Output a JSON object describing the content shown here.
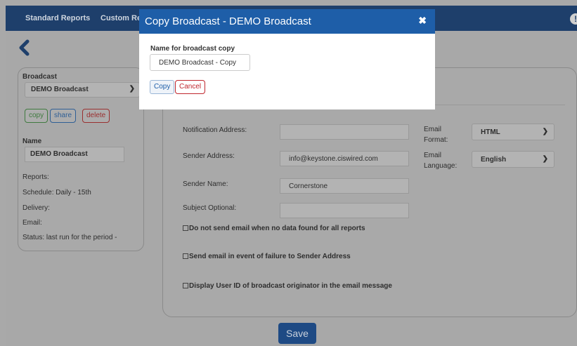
{
  "topbar": {
    "items": [
      "Standard Reports",
      "Custom Repo"
    ],
    "alert_icon": "!"
  },
  "broadcast_panel": {
    "broadcast_label": "Broadcast",
    "broadcast_selected": "DEMO Broadcast",
    "buttons": {
      "copy": "copy",
      "share": "share",
      "delete": "delete"
    },
    "name_label": "Name",
    "name_value": "DEMO Broadcast",
    "reports": "Reports:",
    "schedule": "Schedule: Daily - 15th",
    "delivery": "Delivery:",
    "email": "Email:",
    "status": "Status: last run for the period -"
  },
  "form": {
    "notification_label": "Notification Address:",
    "notification_value": "",
    "sender_address_label": "Sender Address:",
    "sender_address_value": "info@keystone.ciswired.com",
    "sender_name_label": "Sender Name:",
    "sender_name_value": "Cornerstone",
    "subject_label": "Subject Optional:",
    "subject_value": "",
    "email_format_label_1": "Email",
    "email_format_label_2": "Format:",
    "email_format_value": "HTML",
    "email_language_label_1": "Email",
    "email_language_label_2": "Language:",
    "email_language_value": "English",
    "checkbox_no_data": "Do not send email when no data found for all reports",
    "checkbox_failure": "Send email in event of failure to Sender Address",
    "checkbox_user_id": "Display User ID of broadcast originator in the email message"
  },
  "save_label": "Save",
  "modal": {
    "title": "Copy Broadcast - DEMO Broadcast",
    "close_glyph": "✖",
    "field_label": "Name for broadcast copy",
    "field_value": "DEMO Broadcast - Copy",
    "copy_label": "Copy",
    "cancel_label": "Cancel"
  },
  "colors": {
    "header_blue": "#1e5ea8",
    "topbar_navy": "#1e3f6b",
    "cancel_red": "#c0262d"
  }
}
